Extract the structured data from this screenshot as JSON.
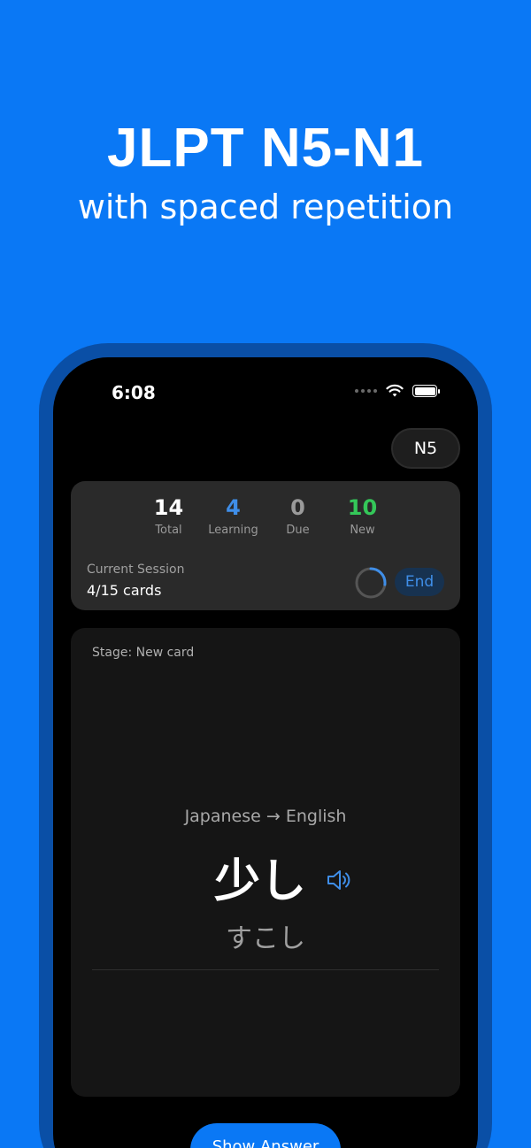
{
  "promo": {
    "headline": "JLPT N5-N1",
    "subheadline": "with spaced repetition"
  },
  "status_bar": {
    "time": "6:08",
    "icons": [
      "cellular-dots-icon",
      "wifi-icon",
      "battery-icon"
    ]
  },
  "level_selector": {
    "label": "N5"
  },
  "stats": {
    "items": [
      {
        "value": "14",
        "label": "Total",
        "color": "#ffffff"
      },
      {
        "value": "4",
        "label": "Learning",
        "color": "#3f8ee8"
      },
      {
        "value": "0",
        "label": "Due",
        "color": "#9a9a9a"
      },
      {
        "value": "10",
        "label": "New",
        "color": "#34c759"
      }
    ],
    "session_label": "Current Session",
    "session_value": "4/15 cards",
    "progress": 0.27,
    "end_label": "End"
  },
  "card": {
    "stage": "Stage: New card",
    "direction": "Japanese → English",
    "word": "少し",
    "reading": "すこし"
  },
  "actions": {
    "show_answer_label": "Show Answer"
  },
  "colors": {
    "background": "#0a78f5",
    "accent": "#3f8ee8",
    "green": "#34c759"
  }
}
